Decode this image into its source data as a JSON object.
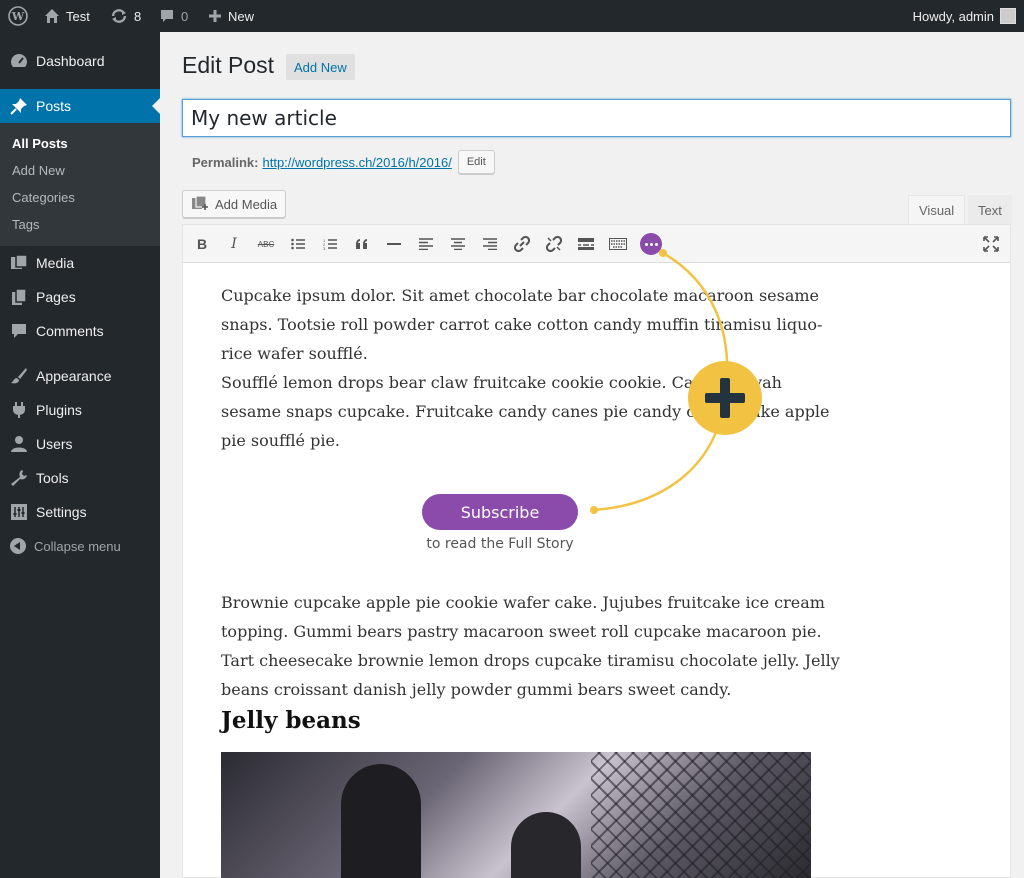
{
  "adminbar": {
    "site_name": "Test",
    "updates_count": "8",
    "comments_count": "0",
    "new_label": "New",
    "howdy": "Howdy, admin"
  },
  "sidebar": {
    "items": [
      {
        "label": "Dashboard",
        "icon": "dashboard-icon"
      },
      {
        "label": "Posts",
        "icon": "pin-icon"
      },
      {
        "label": "Media",
        "icon": "media-icon"
      },
      {
        "label": "Pages",
        "icon": "pages-icon"
      },
      {
        "label": "Comments",
        "icon": "comments-icon"
      },
      {
        "label": "Appearance",
        "icon": "paintbrush-icon"
      },
      {
        "label": "Plugins",
        "icon": "plugin-icon"
      },
      {
        "label": "Users",
        "icon": "users-icon"
      },
      {
        "label": "Tools",
        "icon": "wrench-icon"
      },
      {
        "label": "Settings",
        "icon": "settings-icon"
      }
    ],
    "submenu": [
      "All Posts",
      "Add New",
      "Categories",
      "Tags"
    ],
    "collapse_label": "Collapse menu"
  },
  "main": {
    "title": "Edit Post",
    "add_new": "Add New",
    "post_title": "My new article",
    "permalink_label": "Permalink:",
    "permalink_url": "http://wordpress.ch/2016/h/2016/",
    "edit_label": "Edit",
    "add_media": "Add Media",
    "tab_visual": "Visual",
    "tab_text": "Text"
  },
  "content": {
    "para1": "Cupcake ipsum dolor. Sit amet chocolate bar chocolate macaroon sesame snaps. Tootsie roll powder carrot cake cotton candy muffin tiramisu liquo-rice wafer soufflé.",
    "para1b": "Soufflé lemon drops bear claw fruitcake cookie cookie. Candy halvah sesame snaps cupcake. Fruitcake candy canes pie candy cheesecake apple pie soufflé pie.",
    "subscribe_label": "Subscribe",
    "subscribe_sub": "to read the Full Story",
    "para2": "Brownie cupcake apple pie cookie wafer cake. Jujubes fruitcake ice cream topping. Gummi bears pastry macaroon sweet roll cupcake macaroon pie. Tart cheesecake brownie lemon drops cupcake tiramisu chocolate jelly. Jelly beans croissant danish jelly powder gummi bears sweet candy.",
    "heading": "Jelly beans"
  },
  "colors": {
    "accent": "#0073aa",
    "purple": "#8a4bab",
    "yellow": "#f2c242"
  }
}
